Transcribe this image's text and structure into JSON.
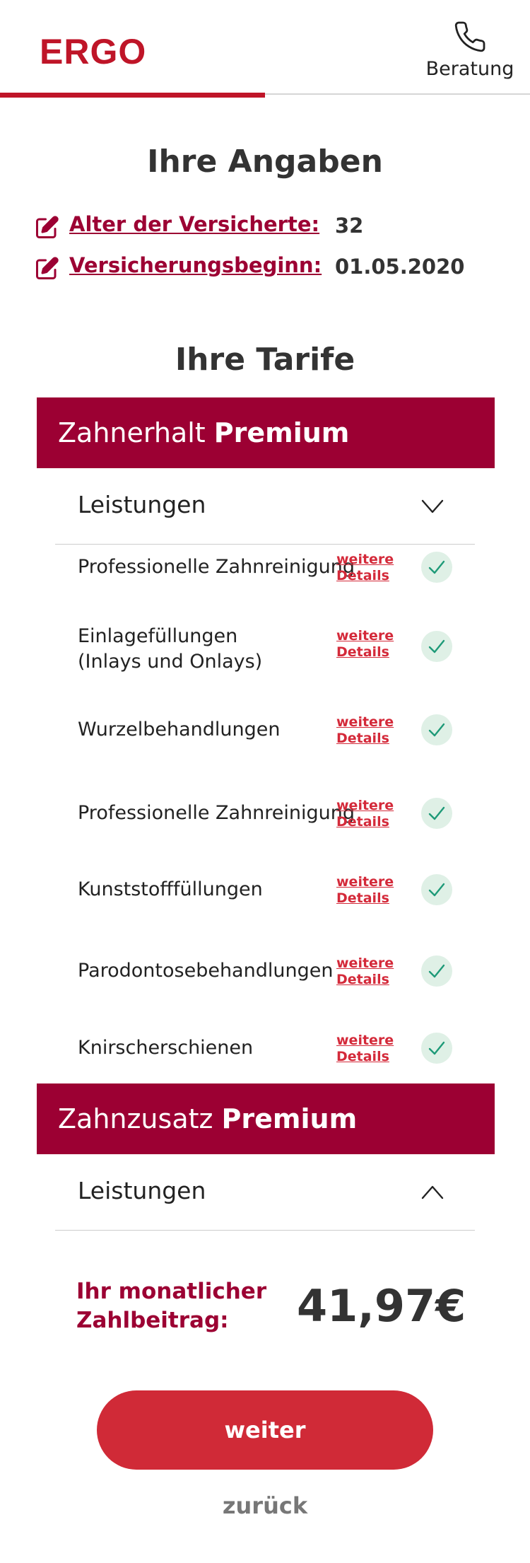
{
  "header": {
    "logo": "ERGO",
    "phone_label": "Beratung"
  },
  "progress": {
    "fraction": 0.5
  },
  "angaben": {
    "title": "Ihre Angaben",
    "rows": [
      {
        "label": "Alter der Versicherte:",
        "value": "32"
      },
      {
        "label": "Versicherungsbeginn:",
        "value": "01.05.2020"
      }
    ]
  },
  "tarife": {
    "title": "Ihre Tarife",
    "plans": [
      {
        "name": "Zahnerhalt",
        "level": "Premium",
        "leistungen_label": "Leistungen",
        "expanded": true,
        "benefits": [
          {
            "label": "Professionelle Zahnreinigung",
            "details": "weitere\nDetails",
            "included": true
          },
          {
            "label": "Einlagefüllungen\n(Inlays und Onlays)",
            "details": "weitere\nDetails",
            "included": true
          },
          {
            "label": "Wurzelbehandlungen",
            "details": "weitere\nDetails",
            "included": true
          },
          {
            "label": "Professionelle Zahnreinigung",
            "details": "weitere\nDetails",
            "included": true
          },
          {
            "label": "Kunststofffüllungen",
            "details": "weitere\nDetails",
            "included": true
          },
          {
            "label": "Parodontosebehandlungen",
            "details": "weitere\nDetails",
            "included": true
          },
          {
            "label": "Knirscherschienen",
            "details": "weitere\nDetails",
            "included": true
          }
        ]
      },
      {
        "name": "Zahnzusatz",
        "level": "Premium",
        "leistungen_label": "Leistungen",
        "expanded": false
      }
    ]
  },
  "price": {
    "label": "Ihr monatlicher Zahlbeitrag:",
    "value": "41,97€"
  },
  "actions": {
    "next_label": "weiter",
    "back_label": "zurück"
  },
  "colors": {
    "brand": "#bf1528",
    "plan_header": "#9c0033",
    "button": "#d02a37",
    "check": "#1e9a78",
    "check_bg": "#dff0e6"
  }
}
